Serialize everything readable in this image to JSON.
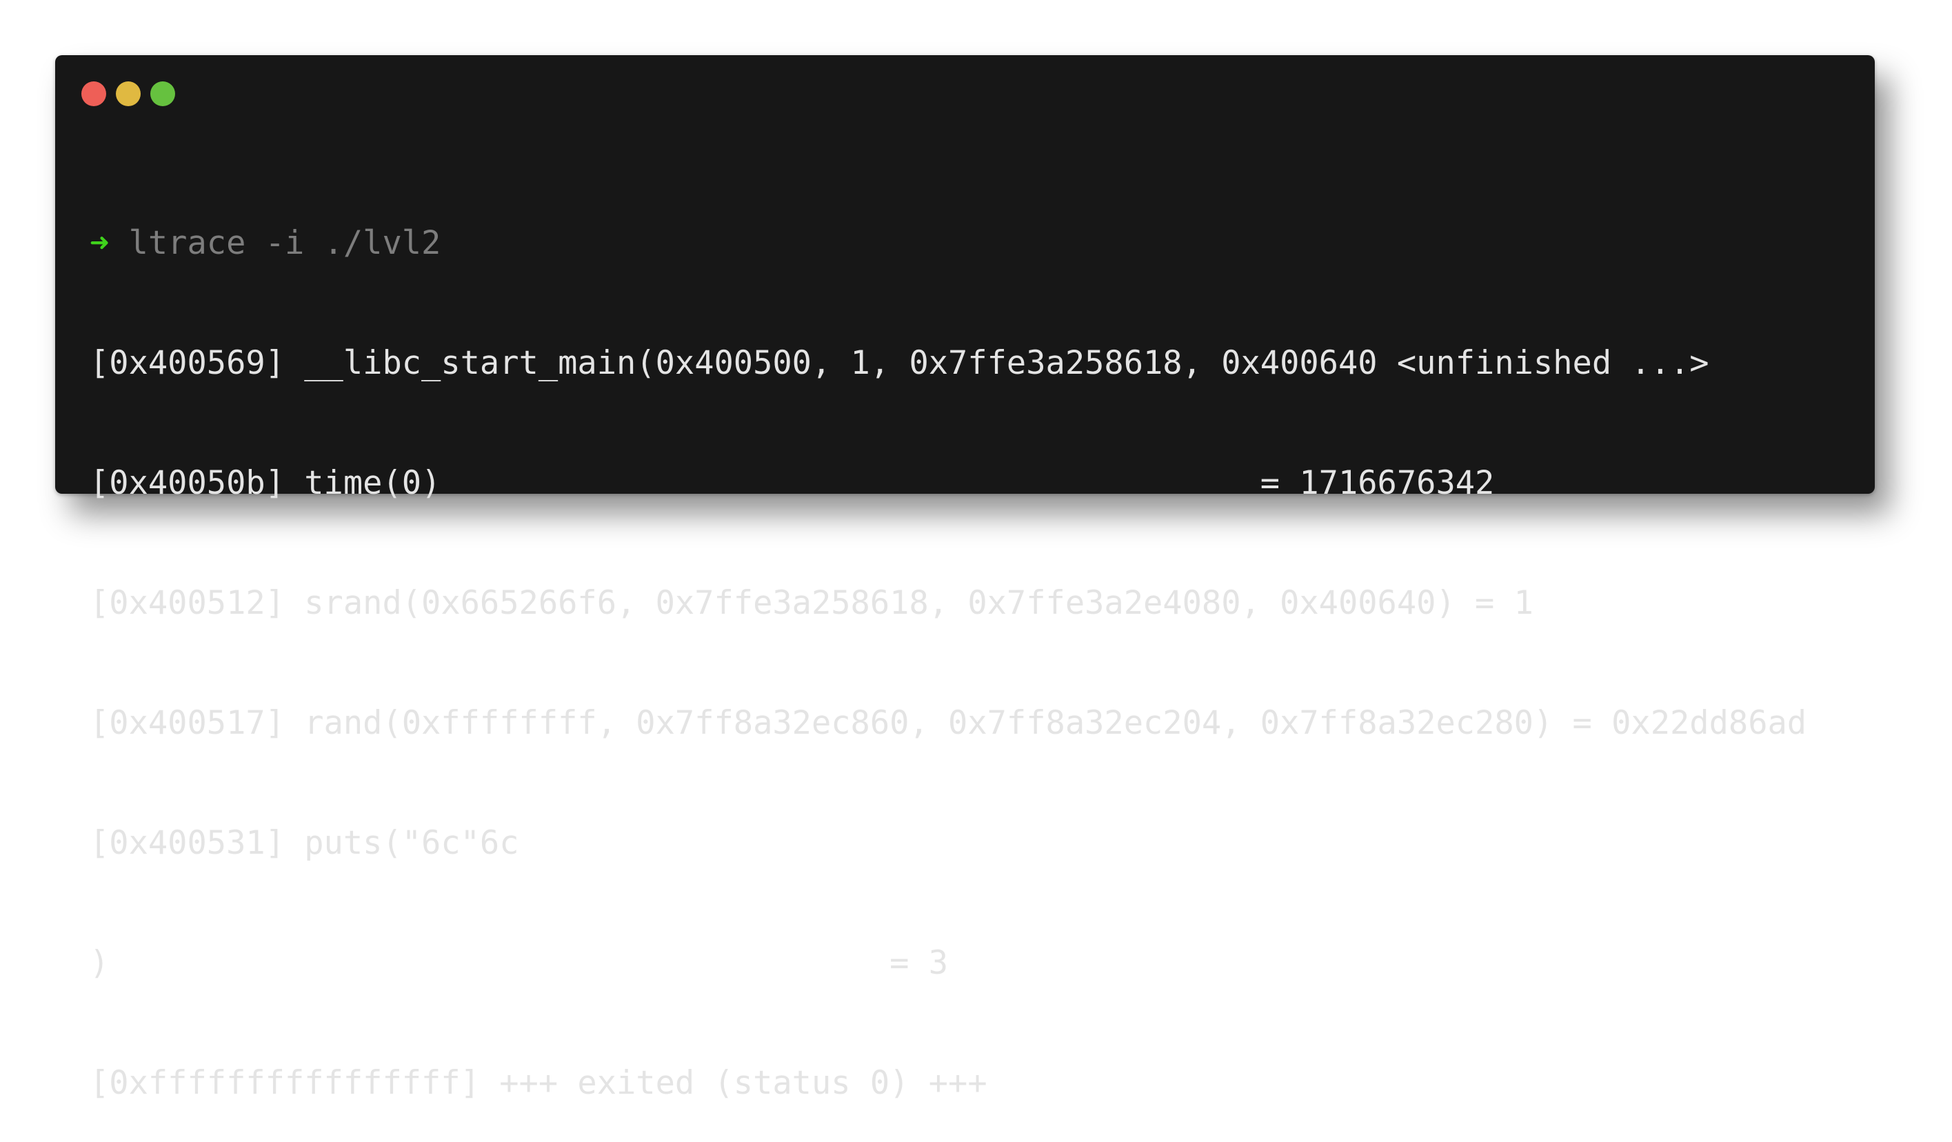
{
  "window": {
    "controls": {
      "close_color": "#ee5f57",
      "minimize_color": "#e0b941",
      "maximize_color": "#66c13f"
    }
  },
  "terminal": {
    "prompt_symbol": "➜",
    "command": " ltrace -i ./lvl2",
    "output_lines": [
      "[0x400569] __libc_start_main(0x400500, 1, 0x7ffe3a258618, 0x400640 <unfinished ...>",
      "[0x40050b] time(0)                                          = 1716676342",
      "[0x400512] srand(0x665266f6, 0x7ffe3a258618, 0x7ffe3a2e4080, 0x400640) = 1",
      "[0x400517] rand(0xffffffff, 0x7ff8a32ec860, 0x7ff8a32ec204, 0x7ff8a32ec280) = 0x22dd86ad",
      "[0x400531] puts(\"6c\"6c",
      ")                                        = 3",
      "[0xffffffffffffffff] +++ exited (status 0) +++"
    ]
  },
  "colors": {
    "background": "#171717",
    "text": "#e4e4e4",
    "prompt_arrow": "#3fd21c",
    "command": "#7d7d7d"
  }
}
